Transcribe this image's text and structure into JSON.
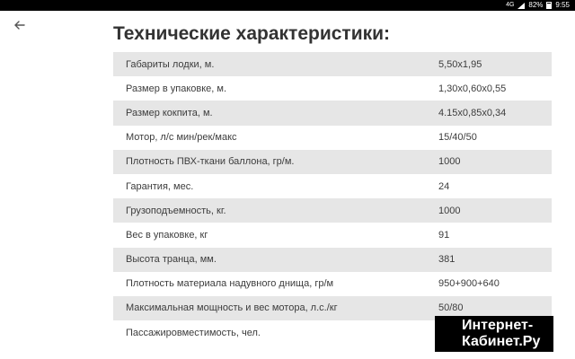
{
  "statusbar": {
    "signal": "4G",
    "battery_percent": "82%",
    "time": "9:55"
  },
  "header": {
    "back_icon": "arrow-left-icon",
    "title": "Технические характеристики:"
  },
  "specs": [
    {
      "label": "Габариты лодки, м.",
      "value": "5,50x1,95"
    },
    {
      "label": "Размер в упаковке, м.",
      "value": "1,30x0,60x0,55"
    },
    {
      "label": "Размер кокпита, м.",
      "value": "4.15x0,85x0,34"
    },
    {
      "label": "Мотор, л/с мин/рек/макс",
      "value": "15/40/50"
    },
    {
      "label": "Плотность ПВХ-ткани баллона, гр/м.",
      "value": "1000"
    },
    {
      "label": "Гарантия, мес.",
      "value": "24"
    },
    {
      "label": "Грузоподъемность, кг.",
      "value": "1000"
    },
    {
      "label": "Вес в упаковке, кг",
      "value": "91"
    },
    {
      "label": "Высота транца, мм.",
      "value": "381"
    },
    {
      "label": "Плотность материала надувного днища, гр/м",
      "value": "950+900+640"
    },
    {
      "label": "Максимальная мощность и вес мотора, л.с./кг",
      "value": "50/80"
    },
    {
      "label": "Пассажировместимость, чел.",
      "value": ""
    }
  ],
  "watermark": {
    "line1": "Интернет-",
    "line2": "Кабинет.Ру"
  },
  "colors": {
    "row_alt_bg": "#e6e6e6",
    "text": "#333333",
    "statusbar_bg": "#000000"
  }
}
